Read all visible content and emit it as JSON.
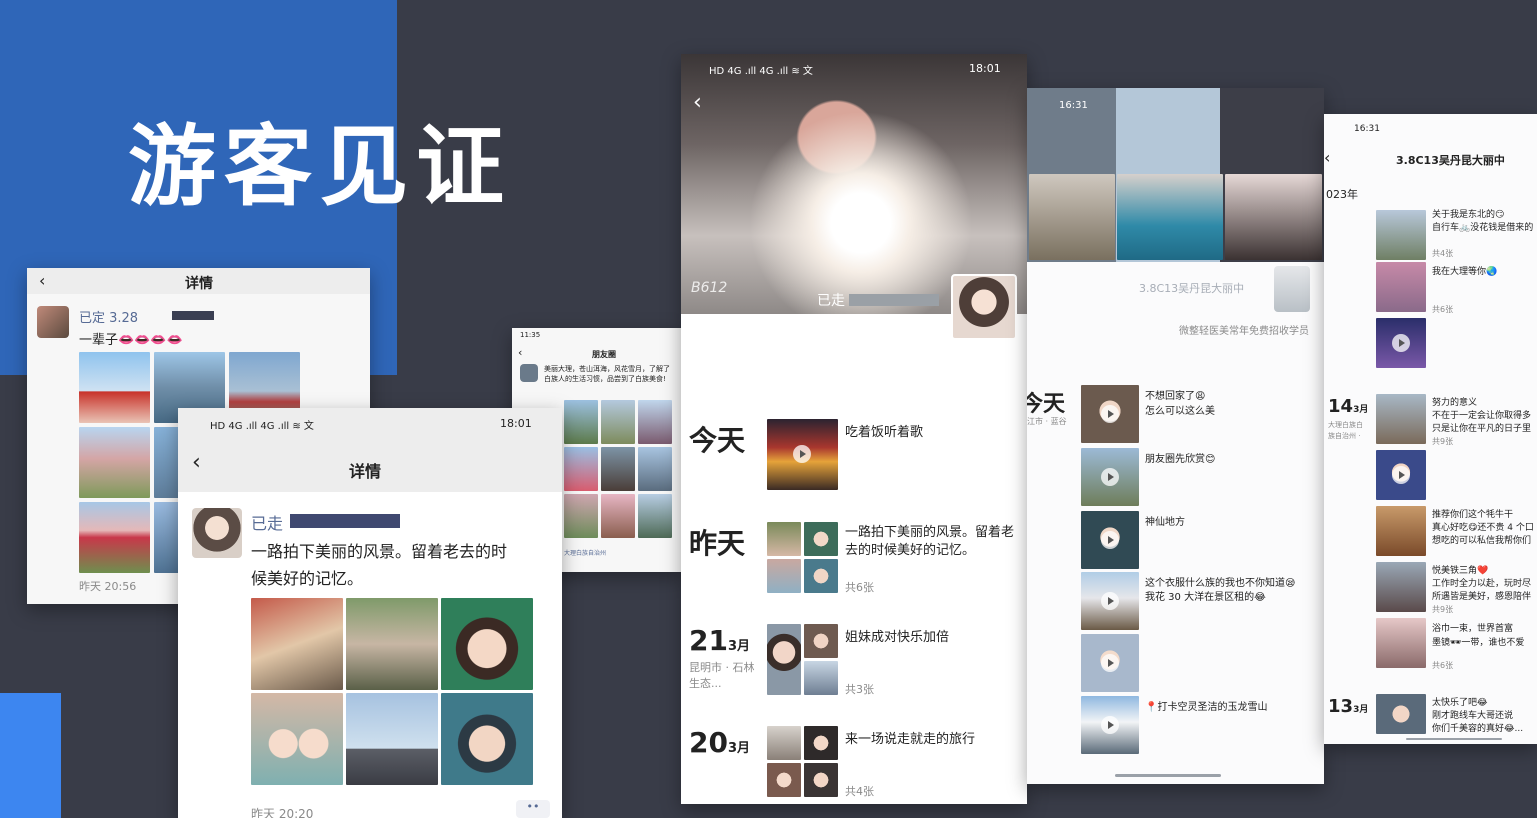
{
  "headline": "游客见证",
  "card1": {
    "nav_title": "详情",
    "user_prefix": "已定 3.28",
    "text": "一辈子",
    "emojis": "👄👄👄👄",
    "time": "昨天 20:56"
  },
  "card2": {
    "status_left": "HD 4G .ıll 4G .ıll ≋ 文",
    "status_right": "18:01",
    "nav_title": "详情",
    "user_prefix": "已走",
    "text_line1": "一路拍下美丽的风景。留着老去的时",
    "text_line2": "候美好的记忆。",
    "time": "昨天 20:20",
    "more": "••"
  },
  "card3": {
    "status_left": "11:35",
    "nav_title": "朋友圈",
    "text": "美丽大理，苍山洱海，风花雪月，了解了白族人的生活习惯，品尝到了白族美食!",
    "location": "大理白族自治州"
  },
  "card4": {
    "status_left": "HD 4G .ıll 4G .ıll ≋ 文",
    "status_right": "18:01",
    "watermark": "B612",
    "user_prefix": "已走",
    "rows": [
      {
        "date": "今天",
        "month": "",
        "place": "",
        "text": "吃着饭听着歌",
        "count": ""
      },
      {
        "date": "昨天",
        "month": "",
        "place": "",
        "text": "一路拍下美丽的风景。留着老去的时候美好的记忆。",
        "count": "共6张"
      },
      {
        "date": "21",
        "month": "3月",
        "place": "昆明市 · 石林生态...",
        "text": "姐妹成对快乐加倍",
        "count": "共3张"
      },
      {
        "date": "20",
        "month": "3月",
        "place": "",
        "text": "来一场说走就走的旅行",
        "count": "共4张"
      }
    ]
  },
  "card5": {
    "status_time": "16:31",
    "name": "3.8C13吴丹昆大丽中",
    "signature": "微整轻医美常年免费招收学员",
    "today": "今天",
    "today_place": "江市 · 蓝谷",
    "posts": [
      "不想回家了😩",
      "怎么可以这么美",
      "朋友圈先欣赏😊",
      "神仙地方",
      "这个衣服什么族的我也不你知道😪",
      "我花 30 大洋在景区租的😂",
      "📍打卡空灵圣洁的玉龙雪山"
    ]
  },
  "card6": {
    "status_time": "16:31",
    "title": "3.8C13吴丹昆大丽中",
    "year": "023年",
    "groups": [
      {
        "date": "",
        "lines": [
          "关于我是东北的😏",
          "自行车🚲没花钱是借来的"
        ],
        "count": "共4张"
      },
      {
        "date": "",
        "lines": [
          "我在大理等你🌏"
        ],
        "count": "共6张"
      },
      {
        "date": "14",
        "month": "3月",
        "place": "大理白族白族自治州 · 鼎...",
        "lines": [
          "努力的意义",
          "不在于一定会让你取得多",
          "只是让你在平凡的日子里"
        ],
        "count": "共9张"
      },
      {
        "date": "",
        "lines": [
          "推荐你们这个牦牛干",
          "真心好吃😋还不贵 4 个口",
          "想吃的可以私信我帮你们"
        ],
        "count": ""
      },
      {
        "date": "",
        "lines": [
          "悦美铁三角❤️",
          "工作时全力以赴，玩时尽",
          "所遇皆是美好，感恩陪伴"
        ],
        "count": "共9张"
      },
      {
        "date": "",
        "lines": [
          "浴巾一束，世界首富",
          "墨镜🕶一带，谁也不爱"
        ],
        "count": "共6张"
      },
      {
        "date": "13",
        "month": "3月",
        "place": "",
        "lines": [
          "太快乐了吧😂",
          "刚才跑线车大哥还说",
          "你们千美容的真好😂..."
        ],
        "count": ""
      }
    ]
  },
  "colors": {
    "blue": "#2f66b8",
    "bright_blue": "#3d86f0",
    "background": "#393c48"
  }
}
